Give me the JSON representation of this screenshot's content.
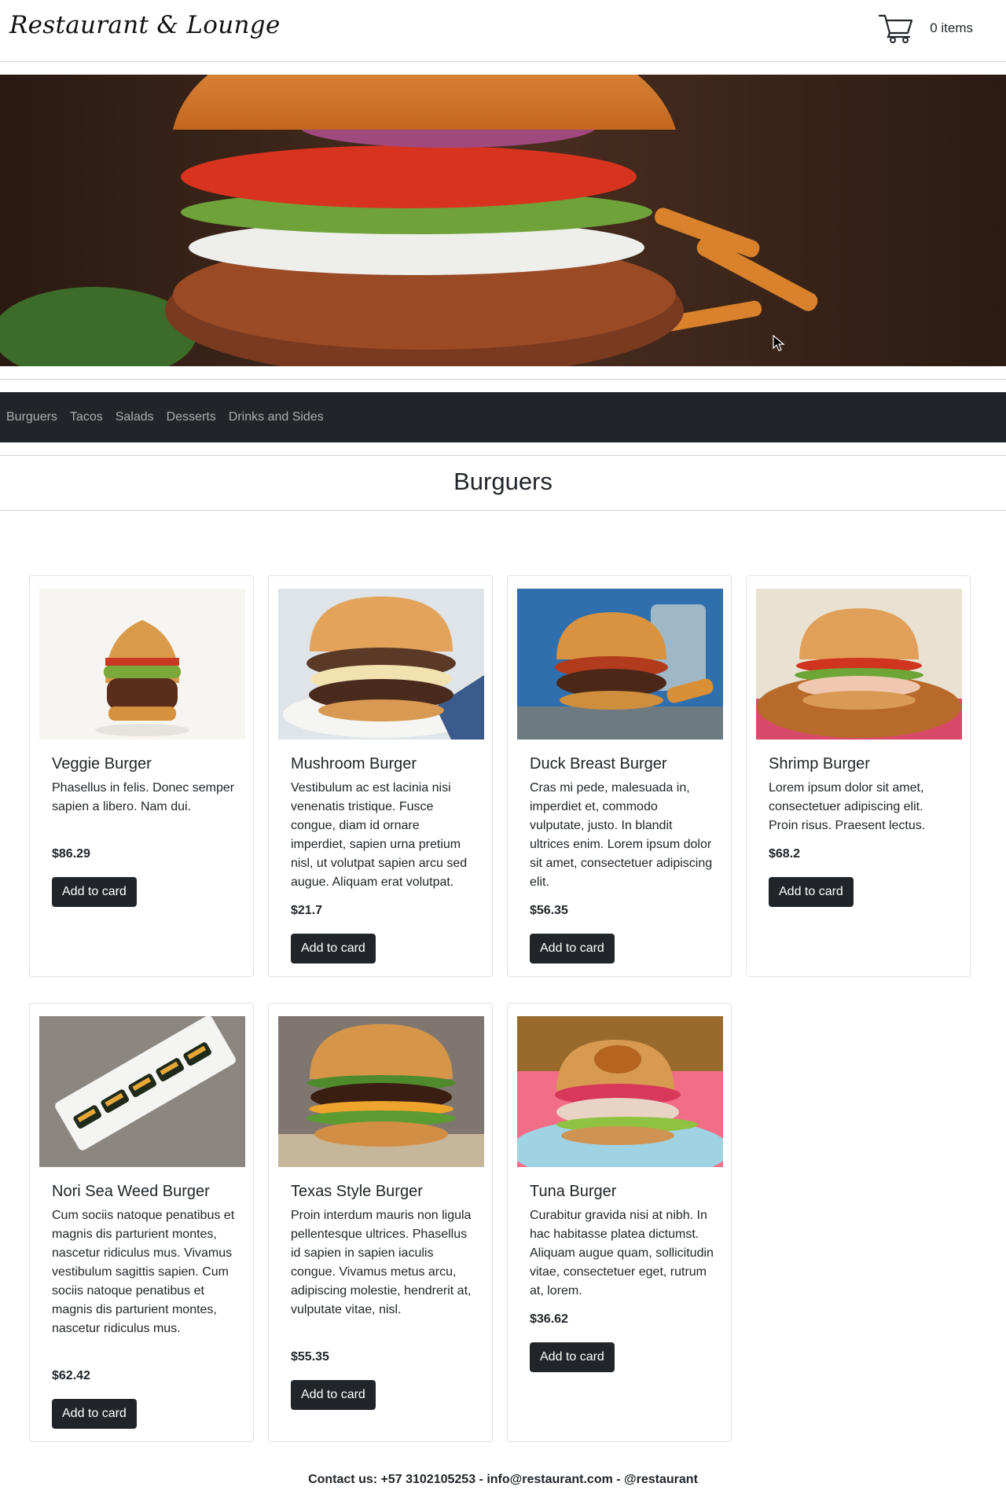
{
  "header": {
    "logo": "Restaurant & Lounge",
    "cart_icon": "cart-icon",
    "cart_count": "0 items"
  },
  "hero": {
    "alt": "burger-hero-image"
  },
  "nav": {
    "items": [
      "Burguers",
      "Tacos",
      "Salads",
      "Desserts",
      "Drinks and Sides"
    ]
  },
  "section": {
    "title": "Burguers"
  },
  "products": [
    {
      "name": "Veggie Burger",
      "desc": "Phasellus in felis. Donec semper sapien a libero. Nam dui.",
      "price": "$86.29",
      "button": "Add to card"
    },
    {
      "name": "Mushroom Burger",
      "desc": "Vestibulum ac est lacinia nisi venenatis tristique. Fusce congue, diam id ornare imperdiet, sapien urna pretium nisl, ut volutpat sapien arcu sed augue. Aliquam erat volutpat.",
      "price": "$21.7",
      "button": "Add to card"
    },
    {
      "name": "Duck Breast Burger",
      "desc": "Cras mi pede, malesuada in, imperdiet et, commodo vulputate, justo. In blandit ultrices enim. Lorem ipsum dolor sit amet, consectetuer adipiscing elit.",
      "price": "$56.35",
      "button": "Add to card"
    },
    {
      "name": "Shrimp Burger",
      "desc": "Lorem ipsum dolor sit amet, consectetuer adipiscing elit. Proin risus. Praesent lectus.",
      "price": "$68.2",
      "button": "Add to card"
    },
    {
      "name": "Nori Sea Weed Burger",
      "desc": "Cum sociis natoque penatibus et magnis dis parturient montes, nascetur ridiculus mus. Vivamus vestibulum sagittis sapien. Cum sociis natoque penatibus et magnis dis parturient montes, nascetur ridiculus mus.",
      "price": "$62.42",
      "button": "Add to card"
    },
    {
      "name": "Texas Style Burger",
      "desc": "Proin interdum mauris non ligula pellentesque ultrices. Phasellus id sapien in sapien iaculis congue. Vivamus metus arcu, adipiscing molestie, hendrerit at, vulputate vitae, nisl.",
      "price": "$55.35",
      "button": "Add to card"
    },
    {
      "name": "Tuna Burger",
      "desc": "Curabitur gravida nisi at nibh. In hac habitasse platea dictumst. Aliquam augue quam, sollicitudin vitae, consectetuer eget, rutrum at, lorem.",
      "price": "$36.62",
      "button": "Add to card"
    }
  ],
  "footer": {
    "contact": "Contact us: +57 3102105253 - info@restaurant.com - @restaurant"
  }
}
